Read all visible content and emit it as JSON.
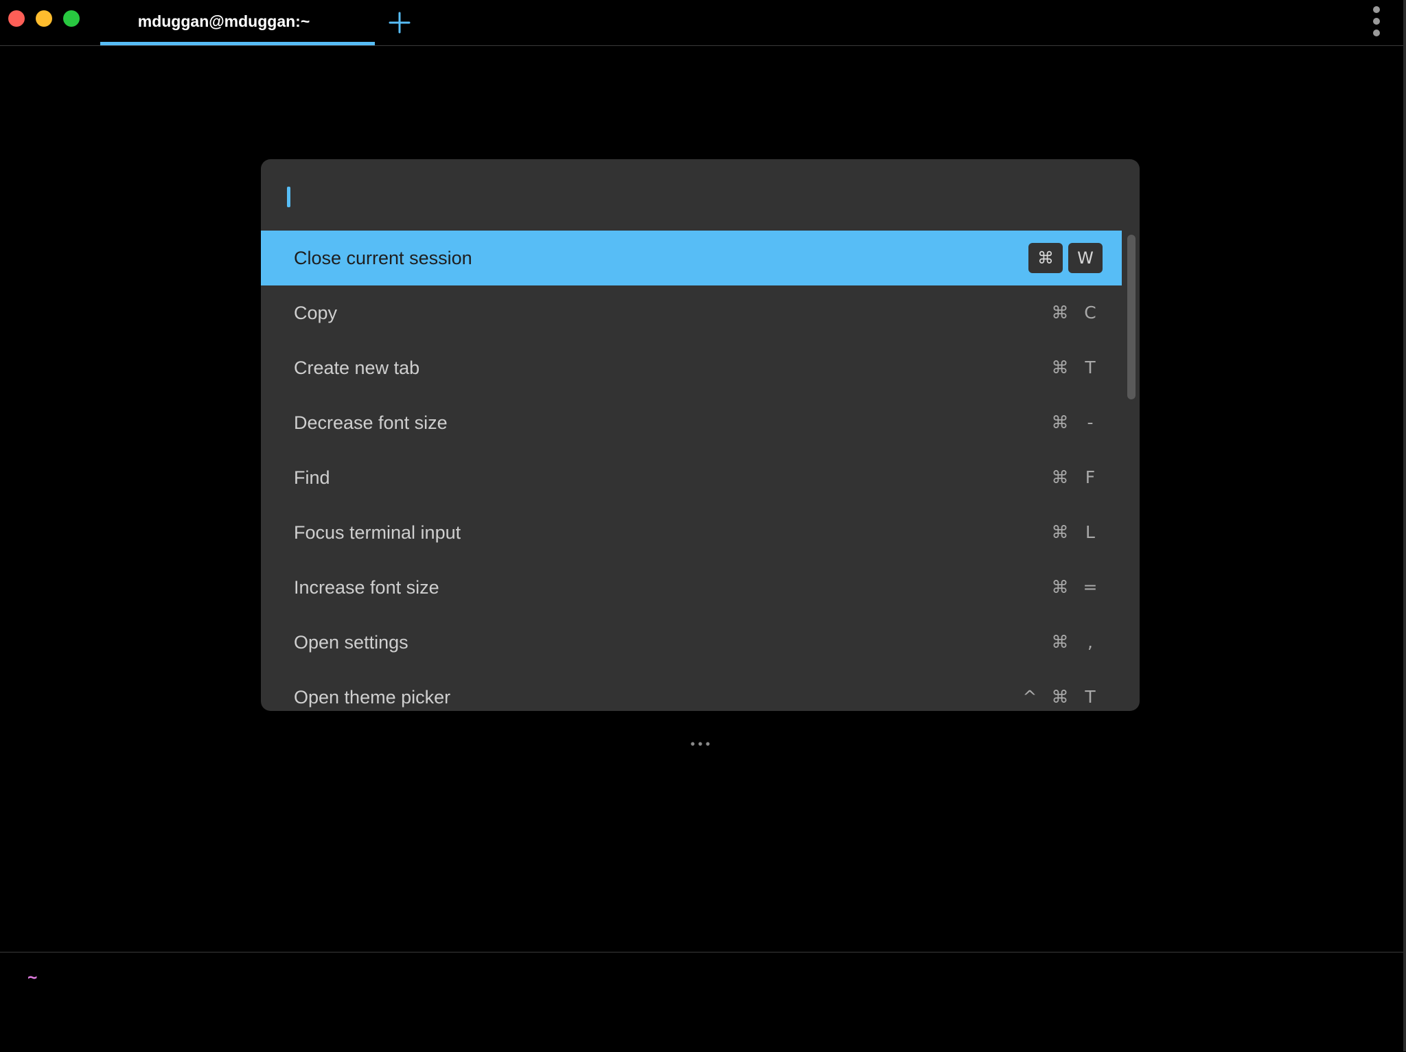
{
  "window": {
    "tab_title": "mduggan@mduggan:~"
  },
  "icons": {
    "new_tab": "plus-icon",
    "menu": "vertical-dots-icon",
    "more": "horizontal-ellipsis-icon"
  },
  "colors": {
    "accent": "#57bdf6",
    "palette_bg": "#333333",
    "background": "#000000",
    "prompt": "#e07be0",
    "close": "#fe5f57",
    "minimize": "#febc2e",
    "maximize": "#28c840"
  },
  "palette": {
    "search": {
      "value": "",
      "placeholder": ""
    },
    "items": [
      {
        "label": "Close current session",
        "keys": [
          "⌘",
          "W"
        ],
        "selected": true
      },
      {
        "label": "Copy",
        "keys": [
          "⌘",
          "C"
        ],
        "selected": false
      },
      {
        "label": "Create new tab",
        "keys": [
          "⌘",
          "T"
        ],
        "selected": false
      },
      {
        "label": "Decrease font size",
        "keys": [
          "⌘",
          "-"
        ],
        "selected": false
      },
      {
        "label": "Find",
        "keys": [
          "⌘",
          "F"
        ],
        "selected": false
      },
      {
        "label": "Focus terminal input",
        "keys": [
          "⌘",
          "L"
        ],
        "selected": false
      },
      {
        "label": "Increase font size",
        "keys": [
          "⌘",
          "="
        ],
        "selected": false
      },
      {
        "label": "Open settings",
        "keys": [
          "⌘",
          ","
        ],
        "selected": false
      },
      {
        "label": "Open theme picker",
        "keys": [
          "^",
          "⌘",
          "T"
        ],
        "selected": false
      }
    ]
  },
  "prompt": {
    "cwd": "~"
  }
}
